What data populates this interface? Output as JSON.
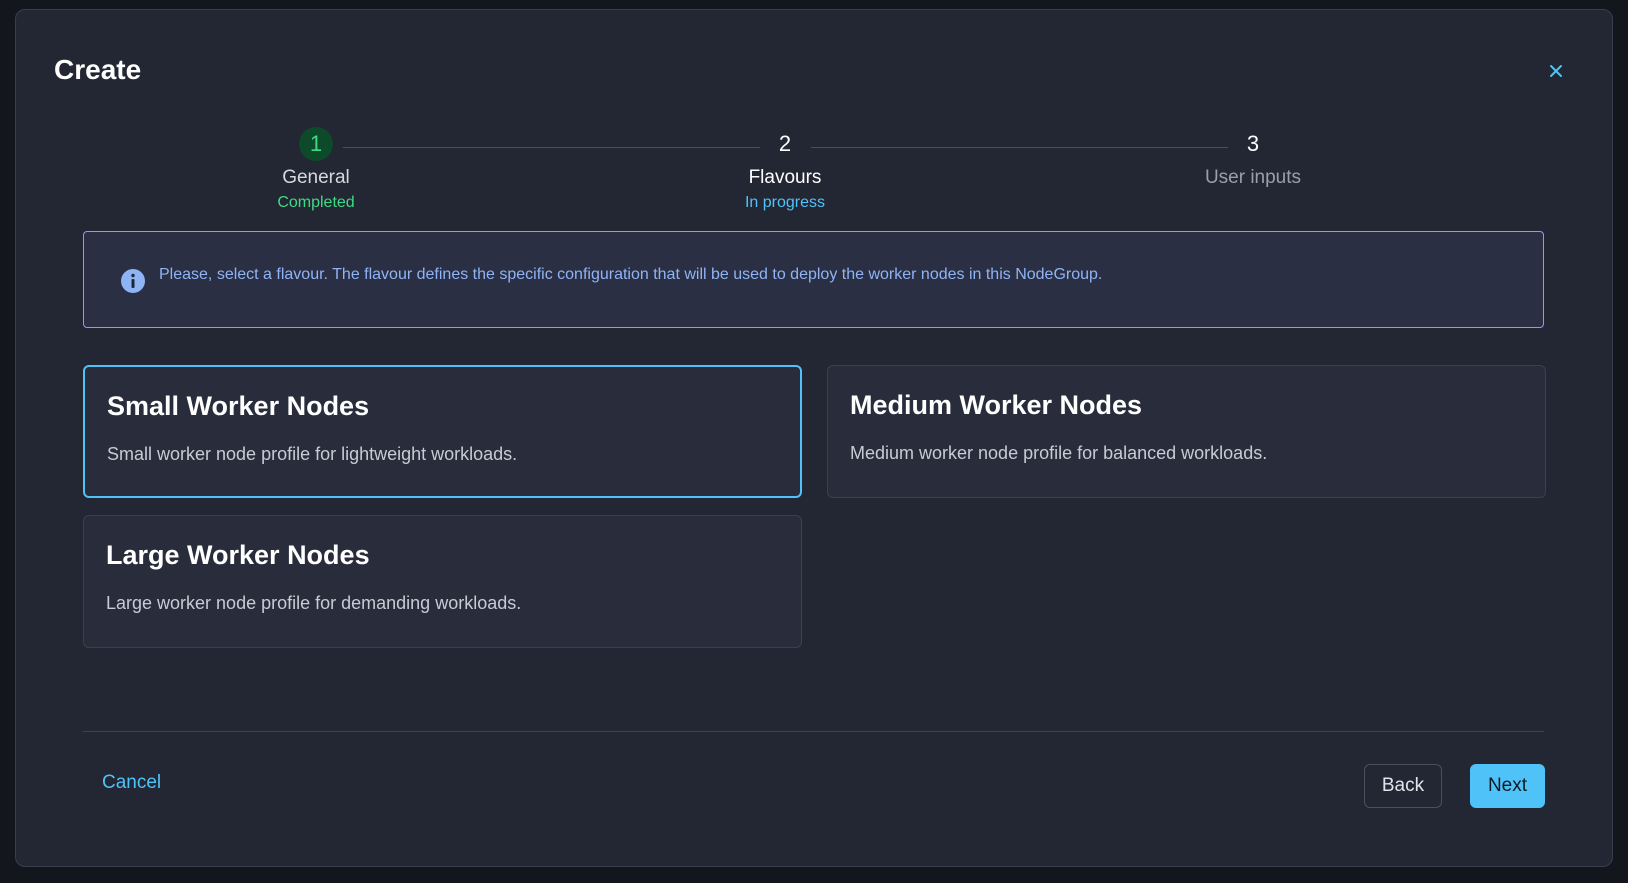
{
  "modal": {
    "title": "Create",
    "close_icon": "close-icon"
  },
  "stepper": {
    "steps": [
      {
        "number": "1",
        "label": "General",
        "status": "Completed",
        "state": "done"
      },
      {
        "number": "2",
        "label": "Flavours",
        "status": "In progress",
        "state": "active"
      },
      {
        "number": "3",
        "label": "User inputs",
        "status": "",
        "state": "pending"
      }
    ]
  },
  "info": {
    "icon": "info-icon",
    "text": "Please, select a flavour. The flavour defines the specific configuration that will be used to deploy the worker nodes in this NodeGroup."
  },
  "flavours": [
    {
      "title": "Small Worker Nodes",
      "description": "Small worker node profile for lightweight workloads.",
      "selected": true
    },
    {
      "title": "Medium Worker Nodes",
      "description": "Medium worker node profile for balanced workloads.",
      "selected": false
    },
    {
      "title": "Large Worker Nodes",
      "description": "Large worker node profile for demanding workloads.",
      "selected": false
    }
  ],
  "footer": {
    "cancel_label": "Cancel",
    "back_label": "Back",
    "next_label": "Next"
  },
  "colors": {
    "accent": "#4fc3f7",
    "success": "#3ddc84",
    "info": "#8fb4f5",
    "background": "#232633"
  }
}
